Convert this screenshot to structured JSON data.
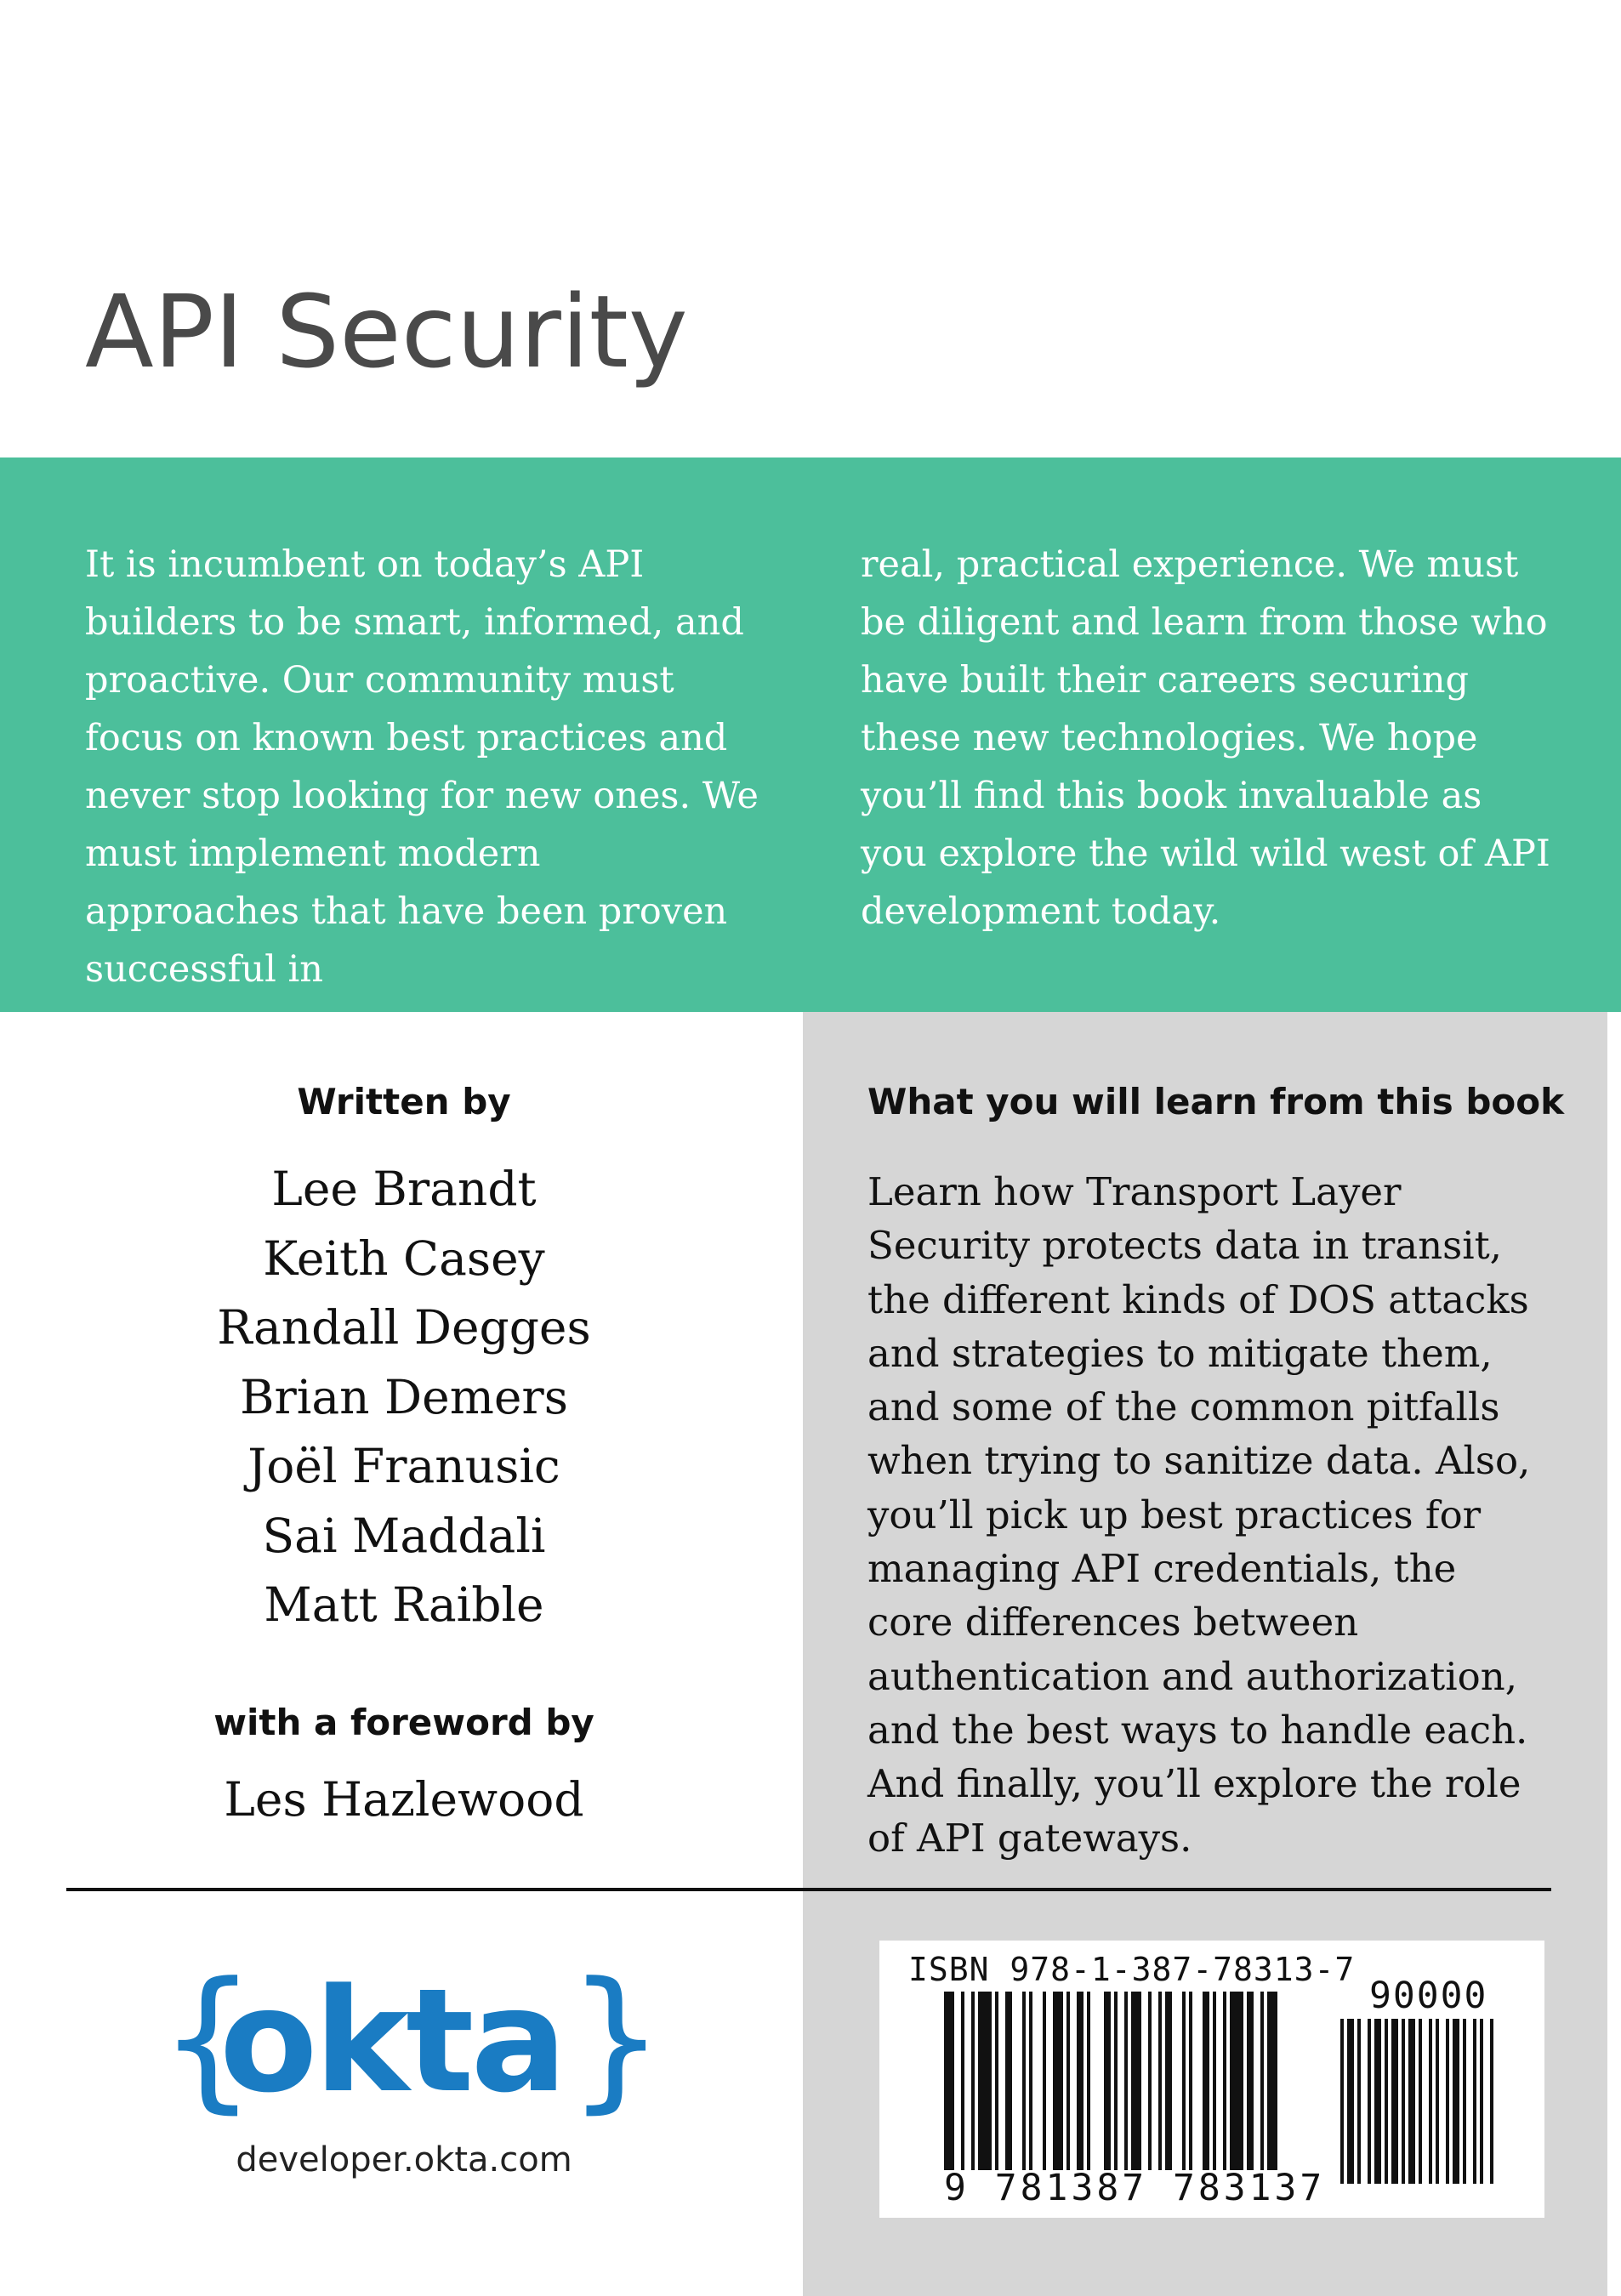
{
  "title": "API Security",
  "summary": {
    "left_text": "It is incumbent on today’s API builders to be smart, informed, and proactive. Our community must focus on known best practices and never stop looking for new ones. We must implement modern approaches that have been proven successful in",
    "right_text": "real, practical experience. We must be diligent and learn from those who have built their careers securing these new technologies. We hope you’ll find this book invaluable as you explore the wild wild west of API development today."
  },
  "written_by": {
    "heading": "Written by",
    "authors": [
      "Lee Brandt",
      "Keith Casey",
      "Randall Degges",
      "Brian Demers",
      "Joël Franusic",
      "Sai Maddali",
      "Matt Raible"
    ]
  },
  "foreword": {
    "heading": "with a foreword by",
    "name": "Les Hazlewood"
  },
  "learn": {
    "heading": "What you will learn from this book",
    "body": "Learn how Transport Layer Security protects data in transit, the different kinds of DOS attacks and strategies to mitigate them, and some of the common pitfalls when trying to sanitize data. Also, you’ll pick up best practices for managing API credentials, the core differences between authentication and authorization, and the best ways to handle each. And finally, you’ll explore the role of API gateways."
  },
  "logo": {
    "open_brace": "{",
    "word": "okta",
    "close_brace": "}",
    "site": "developer.okta.com"
  },
  "barcode": {
    "isbn": "ISBN 978-1-387-78313-7",
    "digits": "9 781387 783137",
    "addon": "90000"
  },
  "colors": {
    "band": "#4cbf9b",
    "panel": "#d6d6d6",
    "logo": "#1a7cc3",
    "title": "#4a4a4a"
  }
}
